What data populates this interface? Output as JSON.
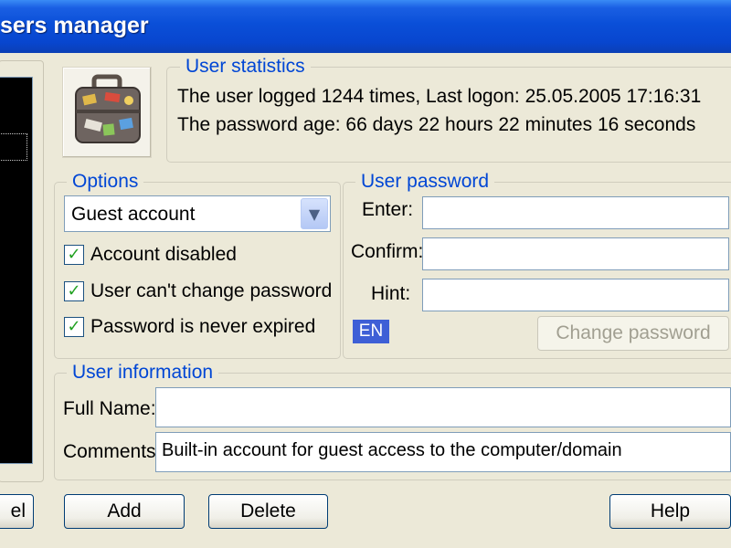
{
  "window": {
    "title": "sers manager"
  },
  "icon": {
    "name": "suitcase-icon"
  },
  "statistics": {
    "legend": "User statistics",
    "line1": "The user logged 1244 times, Last logon: 25.05.2005 17:16:31",
    "line2": "The password age: 66 days 22 hours 22 minutes 16 seconds"
  },
  "options": {
    "legend": "Options",
    "account_type": "Guest account",
    "checkboxes": [
      {
        "label": "Account disabled",
        "checked": true
      },
      {
        "label": "User can't change password",
        "checked": true
      },
      {
        "label": "Password is never expired",
        "checked": true
      }
    ]
  },
  "password": {
    "legend": "User password",
    "enter_label": "Enter:",
    "confirm_label": "Confirm:",
    "hint_label": "Hint:",
    "enter_value": "",
    "confirm_value": "",
    "hint_value": "",
    "language_badge": "EN",
    "change_button": "Change password"
  },
  "user_info": {
    "legend": "User information",
    "full_name_label": "Full Name:",
    "full_name_value": "",
    "comments_label": "Comments:",
    "comments_value": "Built-in account for guest access to the computer/domain"
  },
  "buttons": {
    "cancel_partial": "el",
    "add": "Add",
    "delete": "Delete",
    "help": "Help"
  },
  "colors": {
    "titlebar": "#0A4FD8",
    "window_bg": "#ECE9D8",
    "legend_text": "#0046D5",
    "check_mark": "#21A121",
    "badge_bg": "#3E5FD6"
  }
}
